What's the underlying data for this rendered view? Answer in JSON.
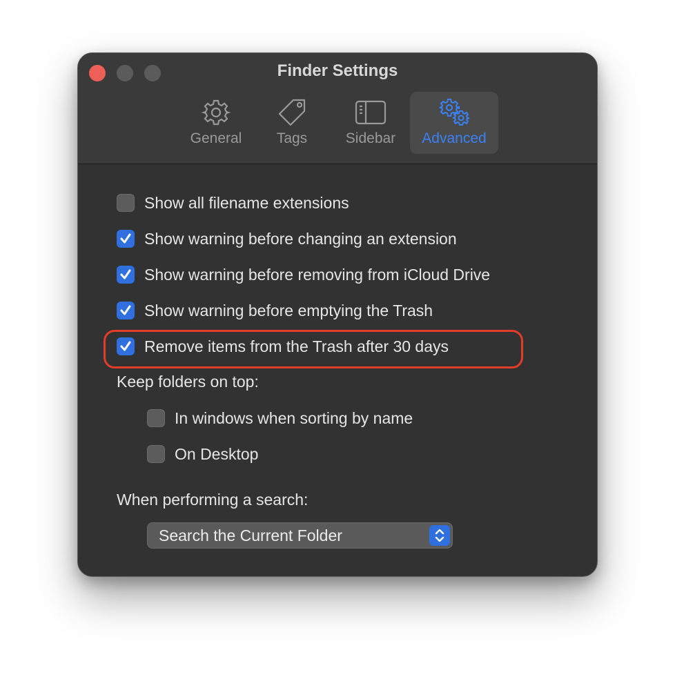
{
  "window": {
    "title": "Finder Settings"
  },
  "tabs": [
    {
      "label": "General",
      "icon": "gear-icon"
    },
    {
      "label": "Tags",
      "icon": "tag-icon"
    },
    {
      "label": "Sidebar",
      "icon": "sidebar-icon"
    },
    {
      "label": "Advanced",
      "icon": "gears-icon",
      "active": true
    }
  ],
  "options": [
    {
      "label": "Show all filename extensions",
      "checked": false
    },
    {
      "label": "Show warning before changing an extension",
      "checked": true
    },
    {
      "label": "Show warning before removing from iCloud Drive",
      "checked": true
    },
    {
      "label": "Show warning before emptying the Trash",
      "checked": true
    },
    {
      "label": "Remove items from the Trash after 30 days",
      "checked": true
    }
  ],
  "folders_on_top": {
    "heading": "Keep folders on top:",
    "items": [
      {
        "label": "In windows when sorting by name",
        "checked": false
      },
      {
        "label": "On Desktop",
        "checked": false
      }
    ]
  },
  "search": {
    "heading": "When performing a search:",
    "selected": "Search the Current Folder"
  },
  "colors": {
    "accent": "#2f6fe0",
    "highlight": "#e23d2a",
    "close": "#ee5f58"
  }
}
